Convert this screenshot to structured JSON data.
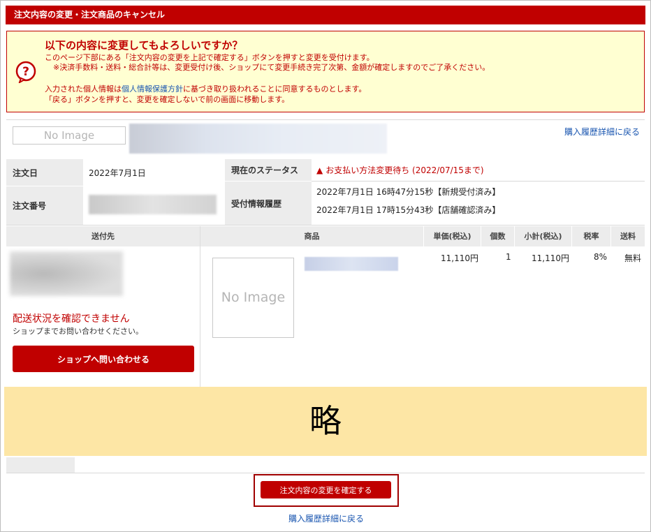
{
  "header": {
    "title": "注文内容の変更・注文商品のキャンセル"
  },
  "notice": {
    "heading": "以下の内容に変更してもよろしいですか？",
    "line1": "このページ下部にある「注文内容の変更を上記で確定する」ボタンを押すと変更を受付けます。",
    "line2": "※決済手数料・送料・総合計等は、変更受付け後、ショップにて変更手続き完了次第、金額が確定しますのでご了承ください。",
    "line3_pre": "入力された個人情報は",
    "privacy_link": "個人情報保護方針",
    "line3_post": "に基づき取り扱われることに同意するものとします。",
    "line4": "「戻る」ボタンを押すと、変更を確定しないで前の画面に移動します。"
  },
  "shop": {
    "no_image_label": "No Image",
    "back_link": "購入履歴詳細に戻る"
  },
  "order_info": {
    "order_date_label": "注文日",
    "order_date": "2022年7月1日",
    "order_number_label": "注文番号",
    "status_label": "現在のステータス",
    "status": "お支払い方法変更待ち (2022/07/15まで)",
    "history_label": "受付情報履歴",
    "history": [
      "2022年7月1日 16時47分15秒【新規受付済み】",
      "2022年7月1日 17時15分43秒【店舗確認済み】"
    ]
  },
  "table": {
    "headers": {
      "ship_to": "送付先",
      "product": "商品",
      "unit_price": "単価(税込)",
      "qty": "個数",
      "subtotal": "小計(税込)",
      "tax_rate": "税率",
      "shipping": "送料"
    },
    "row": {
      "no_image_label": "No Image",
      "unit_price": "11,110円",
      "qty": "1",
      "subtotal": "11,110円",
      "tax_rate": "8%",
      "shipping": "無料"
    }
  },
  "shipping": {
    "status_msg": "配送状況を確認できません",
    "sub_msg": "ショップまでお問い合わせください。",
    "contact_button": "ショップへ問い合わせる"
  },
  "omitted": {
    "label": "略"
  },
  "footer": {
    "confirm_button": "注文内容の変更を確定する",
    "back_link": "購入履歴詳細に戻る"
  },
  "colors": {
    "brand_red": "#c00000",
    "notice_bg": "#ffffd2",
    "omit_bg": "#fde6a5",
    "link_blue": "#1a56b0"
  }
}
